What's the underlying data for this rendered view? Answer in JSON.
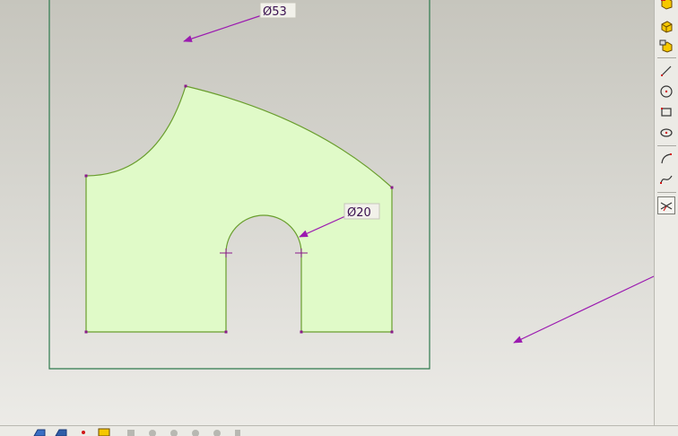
{
  "drawing": {
    "dimensions": [
      {
        "id": "outer-diameter",
        "text": "Ø53"
      },
      {
        "id": "slot-diameter",
        "text": "Ø20"
      }
    ],
    "colors": {
      "profile_fill": "#e0fac8",
      "profile_stroke": "#6a9e2e",
      "vertex_marker": "#8a1a8a",
      "dimension_arrow": "#9b1ab0",
      "sheet_frame": "#2e7a4e"
    }
  },
  "right_toolbar": {
    "tools": [
      {
        "icon": "part-view-icon"
      },
      {
        "icon": "part-shaded-icon"
      },
      {
        "icon": "assembly-view-icon"
      },
      {
        "icon": "line-tool-icon"
      },
      {
        "icon": "circle-tool-icon"
      },
      {
        "icon": "rectangle-tool-icon"
      },
      {
        "icon": "ellipse-tool-icon"
      },
      {
        "icon": "arc-tool-icon"
      },
      {
        "icon": "spline-tool-icon"
      },
      {
        "icon": "trim-tool-icon",
        "active": true
      }
    ]
  },
  "bottom_toolbar": {
    "tools": [
      {
        "icon": "view-front-icon"
      },
      {
        "icon": "view-iso-icon"
      },
      {
        "icon": "point-icon"
      },
      {
        "icon": "open-part-icon"
      },
      {
        "icon": "disabled-tools-icon"
      }
    ]
  }
}
